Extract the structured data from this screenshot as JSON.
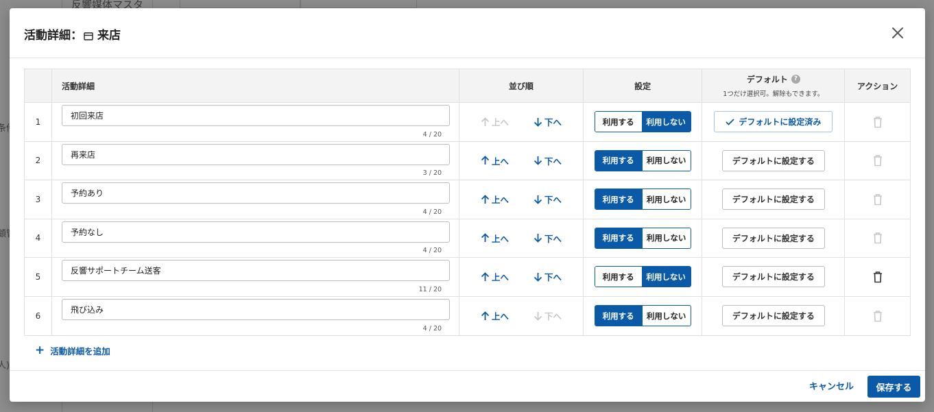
{
  "background": {
    "top_label": "反響媒体マスタ",
    "left_fragment_1": "条件",
    "left_fragment_2": "顧管",
    "left_fragment_3": "人)"
  },
  "modal": {
    "title_prefix": "活動詳細：",
    "title_icon": "store-icon",
    "title_suffix": "来店",
    "close_icon": "close-icon"
  },
  "table": {
    "headers": {
      "number": "",
      "detail": "活動詳細",
      "order": "並び順",
      "setting": "設定",
      "default": "デフォルト",
      "default_help_icon": "?",
      "default_note": "1つだけ選択可。解除もできます。",
      "action": "アクション"
    },
    "rows": [
      {
        "number": "1",
        "value": "初回来店",
        "count": "4 / 20",
        "up": "上へ",
        "down": "下へ",
        "use": "利用する",
        "nouse": "利用しない",
        "default_label": "デフォルトに設定済み"
      },
      {
        "number": "2",
        "value": "再来店",
        "count": "3 / 20",
        "up": "上へ",
        "down": "下へ",
        "use": "利用する",
        "nouse": "利用しない",
        "default_label": "デフォルトに設定する"
      },
      {
        "number": "3",
        "value": "予約あり",
        "count": "4 / 20",
        "up": "上へ",
        "down": "下へ",
        "use": "利用する",
        "nouse": "利用しない",
        "default_label": "デフォルトに設定する"
      },
      {
        "number": "4",
        "value": "予約なし",
        "count": "4 / 20",
        "up": "上へ",
        "down": "下へ",
        "use": "利用する",
        "nouse": "利用しない",
        "default_label": "デフォルトに設定する"
      },
      {
        "number": "5",
        "value": "反響サポートチーム送客",
        "count": "11 / 20",
        "up": "上へ",
        "down": "下へ",
        "use": "利用する",
        "nouse": "利用しない",
        "default_label": "デフォルトに設定する"
      },
      {
        "number": "6",
        "value": "飛び込み",
        "count": "4 / 20",
        "up": "上へ",
        "down": "下へ",
        "use": "利用する",
        "nouse": "利用しない",
        "default_label": "デフォルトに設定する"
      }
    ]
  },
  "add_label": "活動詳細を追加",
  "footer": {
    "cancel": "キャンセル",
    "save": "保存する"
  },
  "colors": {
    "accent": "#0b5aa8",
    "disabled": "#c8c8c8"
  }
}
